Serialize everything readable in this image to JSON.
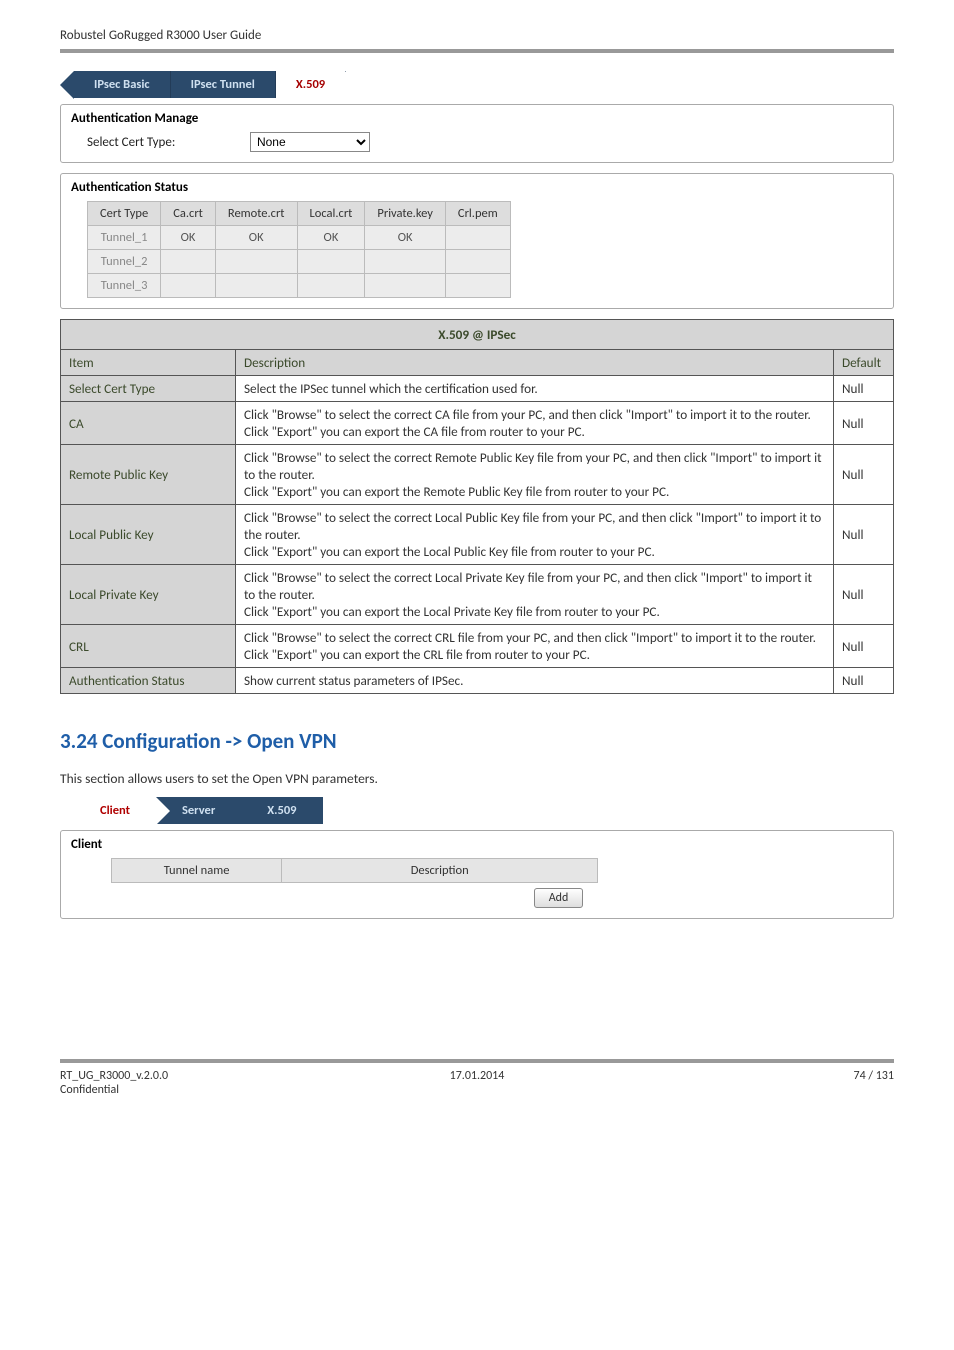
{
  "doc_header": "Robustel GoRugged R3000 User Guide",
  "ipsec_tabs": {
    "basic": "IPsec Basic",
    "tunnel": "IPsec Tunnel",
    "x509": "X.509"
  },
  "auth_manage": {
    "title": "Authentication Manage",
    "label": "Select Cert Type:",
    "options": [
      "None"
    ],
    "selected": "None"
  },
  "auth_status": {
    "title": "Authentication Status",
    "columns": [
      "Cert Type",
      "Ca.crt",
      "Remote.crt",
      "Local.crt",
      "Private.key",
      "Crl.pem"
    ],
    "rows": [
      {
        "name": "Tunnel_1",
        "cells": [
          "OK",
          "OK",
          "OK",
          "OK",
          ""
        ]
      },
      {
        "name": "Tunnel_2",
        "cells": [
          "",
          "",
          "",
          "",
          ""
        ]
      },
      {
        "name": "Tunnel_3",
        "cells": [
          "",
          "",
          "",
          "",
          ""
        ]
      }
    ]
  },
  "desc_table": {
    "title": "X.509 @ IPSec",
    "columns": [
      "Item",
      "Description",
      "Default"
    ],
    "rows": [
      {
        "item": "Select Cert Type",
        "desc": "Select the IPSec tunnel which the certification used for.",
        "default": "Null"
      },
      {
        "item": "CA",
        "desc": "Click \"Browse\" to select the correct CA file from your PC, and then click \"Import\" to import it to the router.\nClick \"Export\" you can export the CA file from router to your PC.",
        "default": "Null"
      },
      {
        "item": "Remote Public Key",
        "desc": "Click \"Browse\" to select the correct Remote Public Key file from your PC, and then click \"Import\" to import it to the router.\nClick \"Export\" you can export the Remote Public Key file from router to your PC.",
        "default": "Null"
      },
      {
        "item": "Local Public Key",
        "desc": "Click \"Browse\" to select the correct Local Public Key file from your PC, and then click \"Import\" to import it to the router.\nClick \"Export\" you can export the Local Public Key file from router to your PC.",
        "default": "Null"
      },
      {
        "item": "Local Private Key",
        "desc": "Click \"Browse\" to select the correct Local Private Key file from your PC, and then click \"Import\" to import it to the router.\nClick \"Export\" you can export the Local Private Key file from router to your PC.",
        "default": "Null"
      },
      {
        "item": "CRL",
        "desc": "Click \"Browse\" to select the correct CRL file from your PC, and then click \"Import\" to import it to the router.\nClick \"Export\" you can export the CRL file from router to your PC.",
        "default": "Null"
      },
      {
        "item": "Authentication Status",
        "desc": "Show current status parameters of IPSec.",
        "default": "Null"
      }
    ]
  },
  "section_heading": "3.24  Configuration -> Open VPN",
  "section_lead": "This section allows users to set the Open VPN parameters.",
  "ovpn_tabs": {
    "client": "Client",
    "server": "Server",
    "x509": "X.509"
  },
  "client_box": {
    "title": "Client",
    "columns": [
      "Tunnel name",
      "Description"
    ],
    "add": "Add"
  },
  "footer": {
    "left1": "RT_UG_R3000_v.2.0.0",
    "left2": "Confidential",
    "center": "17.01.2014",
    "right": "74 / 131"
  }
}
